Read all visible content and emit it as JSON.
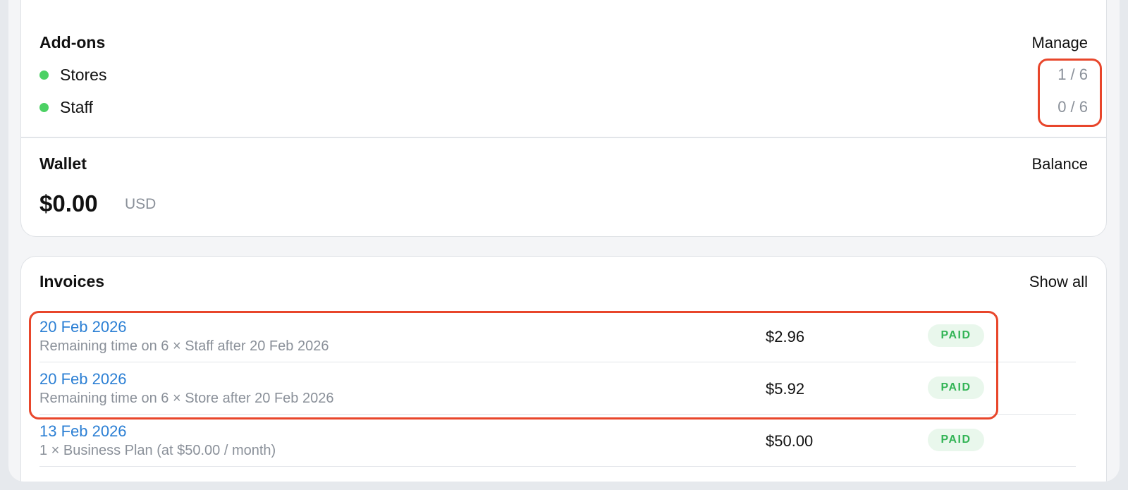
{
  "addons": {
    "title": "Add-ons",
    "action": "Manage",
    "items": [
      {
        "label": "Stores",
        "count": "1 / 6",
        "status_color": "#4cd164"
      },
      {
        "label": "Staff",
        "count": "0 / 6",
        "status_color": "#4cd164"
      }
    ]
  },
  "wallet": {
    "title": "Wallet",
    "action": "Balance",
    "amount": "$0.00",
    "currency": "USD"
  },
  "invoices": {
    "title": "Invoices",
    "action": "Show all",
    "rows": [
      {
        "date": "20 Feb 2026",
        "description": "Remaining time on 6 × Staff after 20 Feb 2026",
        "amount": "$2.96",
        "status": "PAID"
      },
      {
        "date": "20 Feb 2026",
        "description": "Remaining time on 6 × Store after 20 Feb 2026",
        "amount": "$5.92",
        "status": "PAID"
      },
      {
        "date": "13 Feb 2026",
        "description": "1 × Business Plan (at $50.00 / month)",
        "amount": "$50.00",
        "status": "PAID"
      }
    ]
  },
  "colors": {
    "link": "#2b7fd4",
    "paid_text": "#33b456",
    "paid_bg": "#e9f7ec",
    "highlight": "#e8462b",
    "status_dot": "#4cd164"
  }
}
